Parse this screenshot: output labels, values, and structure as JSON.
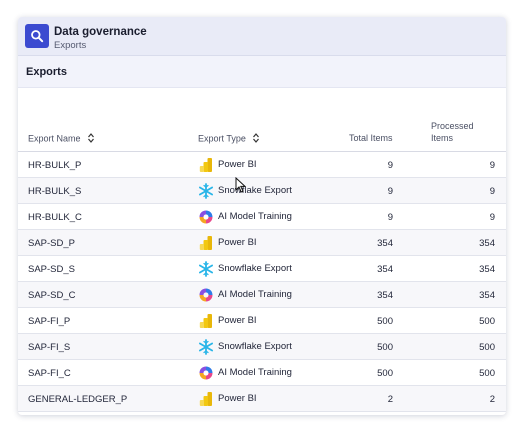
{
  "header": {
    "title": "Data governance",
    "subtitle": "Exports",
    "icon": "search-icon"
  },
  "section": {
    "title": "Exports"
  },
  "table": {
    "columns": {
      "name": "Export Name",
      "type": "Export Type",
      "total": "Total Items",
      "processed_line1": "Processed",
      "processed_line2": "Items"
    },
    "rows": [
      {
        "name": "HR-BULK_P",
        "type": "Power BI",
        "icon": "power-bi-icon",
        "total": "9",
        "processed": "9"
      },
      {
        "name": "HR-BULK_S",
        "type": "Snowflake Export",
        "icon": "snowflake-icon",
        "total": "9",
        "processed": "9"
      },
      {
        "name": "HR-BULK_C",
        "type": "AI Model Training",
        "icon": "ai-model-icon",
        "total": "9",
        "processed": "9"
      },
      {
        "name": "SAP-SD_P",
        "type": "Power BI",
        "icon": "power-bi-icon",
        "total": "354",
        "processed": "354"
      },
      {
        "name": "SAP-SD_S",
        "type": "Snowflake Export",
        "icon": "snowflake-icon",
        "total": "354",
        "processed": "354"
      },
      {
        "name": "SAP-SD_C",
        "type": "AI Model Training",
        "icon": "ai-model-icon",
        "total": "354",
        "processed": "354"
      },
      {
        "name": "SAP-FI_P",
        "type": "Power BI",
        "icon": "power-bi-icon",
        "total": "500",
        "processed": "500"
      },
      {
        "name": "SAP-FI_S",
        "type": "Snowflake Export",
        "icon": "snowflake-icon",
        "total": "500",
        "processed": "500"
      },
      {
        "name": "SAP-FI_C",
        "type": "AI Model Training",
        "icon": "ai-model-icon",
        "total": "500",
        "processed": "500"
      },
      {
        "name": "GENERAL-LEDGER_P",
        "type": "Power BI",
        "icon": "power-bi-icon",
        "total": "2",
        "processed": "2"
      }
    ]
  },
  "colors": {
    "accent": "#3c4bd0",
    "header_bg": "#e9ebf7",
    "powerbi": "#f2c811",
    "snowflake": "#29b5e8"
  }
}
